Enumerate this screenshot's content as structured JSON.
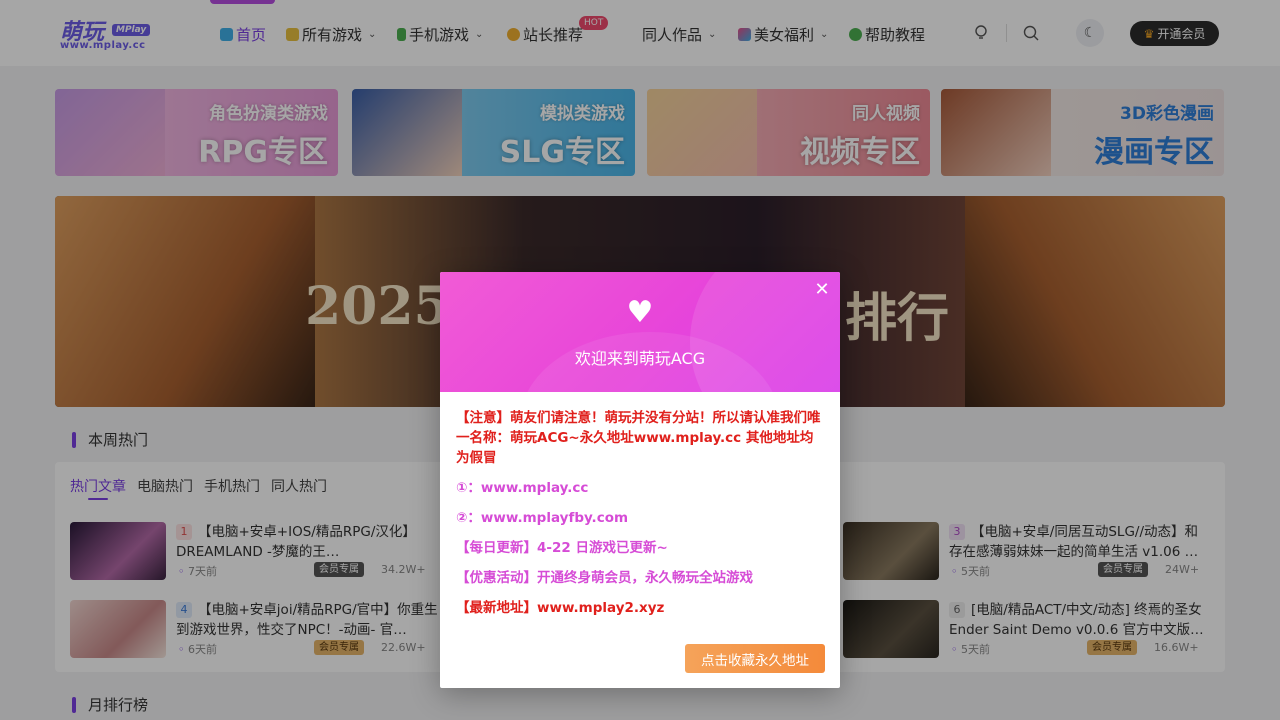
{
  "header": {
    "logo_cn": "萌玩",
    "logo_badge": "MPlay",
    "logo_url": "www.mplay.cc",
    "nav": [
      {
        "label": "首页"
      },
      {
        "label": "所有游戏"
      },
      {
        "label": "手机游戏"
      },
      {
        "label": "站长推荐"
      },
      {
        "label": "同人作品"
      },
      {
        "label": "美女福利"
      },
      {
        "label": "帮助教程"
      }
    ],
    "hot_badge": "HOT",
    "vip_label": "开通会员"
  },
  "banners": [
    {
      "sub": "角色扮演类游戏",
      "main": "RPG专区"
    },
    {
      "sub": "模拟类游戏",
      "main": "SLG专区"
    },
    {
      "sub": "同人视频",
      "main": "视频专区"
    },
    {
      "sub": "3D彩色漫画",
      "main": "漫画专区"
    }
  ],
  "hero": {
    "title_left": "2025",
    "title_right": "排行"
  },
  "weekly": {
    "title": "本周热门",
    "tabs": [
      "热门文章",
      "电脑热门",
      "手机热门",
      "同人热门"
    ],
    "posts": [
      {
        "rank": "1",
        "title": "【电脑+安卓+IOS/精品RPG/汉化】DREAMLAND -梦魔的王…",
        "time": "7天前",
        "vip": "会员专属",
        "views": "34.2W+"
      },
      {
        "rank": "3",
        "title": "【电脑+安卓/同居互动SLG//动态】和存在感薄弱妹妹一起的简单生活 v1.06 …",
        "time": "5天前",
        "vip": "会员专属",
        "views": "24W+"
      },
      {
        "rank": "4",
        "title": "【电脑+安卓joi/精品RPG/官中】你重生到游戏世界，性交了NPC！-动画- 官…",
        "time": "6天前",
        "vip": "会员专属",
        "views": "22.6W+"
      },
      {
        "rank": "6",
        "title": "[电脑/精品ACT/中文/动态] 终焉的圣女 Ender Saint Demo v0.0.6 官方中文版…",
        "time": "5天前",
        "vip": "会员专属",
        "views": "16.6W+"
      }
    ]
  },
  "monthly": {
    "title": "月排行榜"
  },
  "modal": {
    "welcome": "欢迎来到萌玩ACG",
    "notice": "【注意】萌友们请注意！萌玩并没有分站！所以请认准我们唯一名称：萌玩ACG~永久地址www.mplay.cc 其他地址均为假冒",
    "link1": "①：www.mplay.cc",
    "link2": "②：www.mplayfby.com",
    "daily": "【每日更新】4-22 日游戏已更新~",
    "promo": "【优惠活动】开通终身萌会员，永久畅玩全站游戏",
    "latest": "【最新地址】www.mplay2.xyz",
    "button": "点击收藏永久地址"
  },
  "colors": {
    "accent": "#7b3fe4",
    "modal_pink": "#e846d9",
    "notice_red": "#e0201c",
    "button_orange": "#f48a3a"
  }
}
